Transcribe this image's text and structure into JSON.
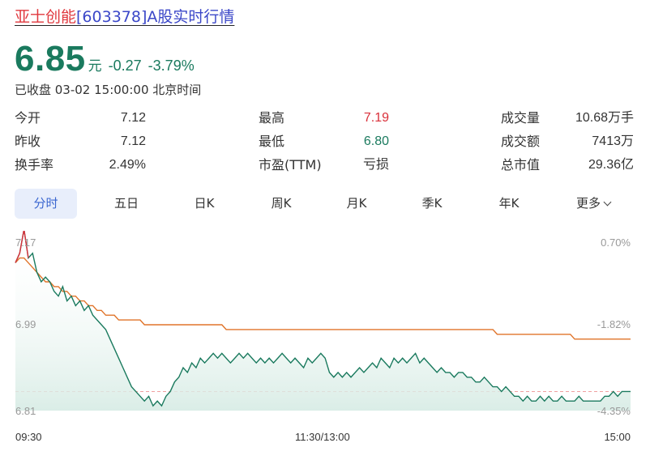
{
  "header": {
    "stock_name": "亚士创能",
    "title_rest": "[603378]A股实时行情"
  },
  "quote": {
    "price": "6.85",
    "unit": "元",
    "change": "-0.27",
    "change_pct": "-3.79%",
    "status": "已收盘 03-02 15:00:00 北京时间"
  },
  "stats": {
    "open_label": "今开",
    "open": "7.12",
    "prev_close_label": "昨收",
    "prev_close": "7.12",
    "turnover_label": "换手率",
    "turnover": "2.49%",
    "high_label": "最高",
    "high": "7.19",
    "low_label": "最低",
    "low": "6.80",
    "pe_label": "市盈(TTM)",
    "pe": "亏损",
    "volume_label": "成交量",
    "volume": "10.68万手",
    "amount_label": "成交额",
    "amount": "7413万",
    "mktcap_label": "总市值",
    "mktcap": "29.36亿"
  },
  "tabs": [
    "分时",
    "五日",
    "日K",
    "周K",
    "月K",
    "季K",
    "年K",
    "更多"
  ],
  "colors": {
    "price_line": "#1a7a5e",
    "avg_line": "#e0742a",
    "spike": "#d9303a",
    "ref_line": "#f0a0a0"
  },
  "chart_data": {
    "type": "line",
    "y_left_labels": [
      "7.17",
      "6.99",
      "6.81"
    ],
    "y_right_labels": [
      "0.70%",
      "-1.82%",
      "-4.35%"
    ],
    "x_labels": [
      "09:30",
      "11:30/13:00",
      "15:00"
    ],
    "ylim": [
      6.81,
      7.17
    ],
    "prev_close": 7.12,
    "series": [
      {
        "values": [
          7.12,
          7.14,
          7.19,
          7.13,
          7.14,
          7.1,
          7.08,
          7.09,
          7.08,
          7.06,
          7.05,
          7.07,
          7.04,
          7.05,
          7.03,
          7.04,
          7.02,
          7.03,
          7.01,
          7.0,
          6.99,
          6.98,
          6.96,
          6.94,
          6.92,
          6.9,
          6.88,
          6.86,
          6.85,
          6.84,
          6.83,
          6.84,
          6.82,
          6.83,
          6.82,
          6.84,
          6.85,
          6.87,
          6.88,
          6.9,
          6.89,
          6.91,
          6.9,
          6.92,
          6.91,
          6.92,
          6.93,
          6.92,
          6.93,
          6.92,
          6.91,
          6.92,
          6.93,
          6.92,
          6.93,
          6.92,
          6.91,
          6.92,
          6.91,
          6.92,
          6.91,
          6.92,
          6.93,
          6.92,
          6.91,
          6.92,
          6.91,
          6.9,
          6.92,
          6.91,
          6.92,
          6.93,
          6.92,
          6.89,
          6.88,
          6.89,
          6.88,
          6.89,
          6.88,
          6.89,
          6.9,
          6.89,
          6.9,
          6.91,
          6.9,
          6.92,
          6.91,
          6.9,
          6.92,
          6.91,
          6.92,
          6.91,
          6.92,
          6.93,
          6.91,
          6.92,
          6.91,
          6.9,
          6.89,
          6.9,
          6.89,
          6.89,
          6.88,
          6.89,
          6.89,
          6.88,
          6.88,
          6.87,
          6.87,
          6.88,
          6.87,
          6.86,
          6.86,
          6.85,
          6.86,
          6.85,
          6.84,
          6.84,
          6.83,
          6.84,
          6.83,
          6.83,
          6.84,
          6.83,
          6.84,
          6.83,
          6.83,
          6.84,
          6.83,
          6.83,
          6.83,
          6.84,
          6.83,
          6.83,
          6.83,
          6.83,
          6.83,
          6.84,
          6.84,
          6.85,
          6.84,
          6.85,
          6.85,
          6.85
        ]
      },
      {
        "values": [
          7.12,
          7.13,
          7.13,
          7.12,
          7.11,
          7.1,
          7.09,
          7.08,
          7.08,
          7.07,
          7.07,
          7.06,
          7.06,
          7.05,
          7.05,
          7.04,
          7.04,
          7.03,
          7.03,
          7.02,
          7.02,
          7.01,
          7.01,
          7.01,
          7.0,
          7.0,
          7.0,
          7.0,
          7.0,
          7.0,
          6.99,
          6.99,
          6.99,
          6.99,
          6.99,
          6.99,
          6.99,
          6.99,
          6.99,
          6.99,
          6.99,
          6.99,
          6.99,
          6.99,
          6.99,
          6.99,
          6.99,
          6.99,
          6.99,
          6.98,
          6.98,
          6.98,
          6.98,
          6.98,
          6.98,
          6.98,
          6.98,
          6.98,
          6.98,
          6.98,
          6.98,
          6.98,
          6.98,
          6.98,
          6.98,
          6.98,
          6.98,
          6.98,
          6.98,
          6.98,
          6.98,
          6.98,
          6.98,
          6.98,
          6.98,
          6.98,
          6.98,
          6.98,
          6.98,
          6.98,
          6.98,
          6.98,
          6.98,
          6.98,
          6.98,
          6.98,
          6.98,
          6.98,
          6.98,
          6.98,
          6.98,
          6.98,
          6.98,
          6.98,
          6.98,
          6.98,
          6.98,
          6.98,
          6.98,
          6.98,
          6.98,
          6.98,
          6.98,
          6.98,
          6.98,
          6.98,
          6.98,
          6.98,
          6.98,
          6.98,
          6.98,
          6.98,
          6.97,
          6.97,
          6.97,
          6.97,
          6.97,
          6.97,
          6.97,
          6.97,
          6.97,
          6.97,
          6.97,
          6.97,
          6.97,
          6.97,
          6.97,
          6.97,
          6.97,
          6.97,
          6.96,
          6.96,
          6.96,
          6.96,
          6.96,
          6.96,
          6.96,
          6.96,
          6.96,
          6.96,
          6.96,
          6.96,
          6.96,
          6.96
        ]
      }
    ]
  }
}
